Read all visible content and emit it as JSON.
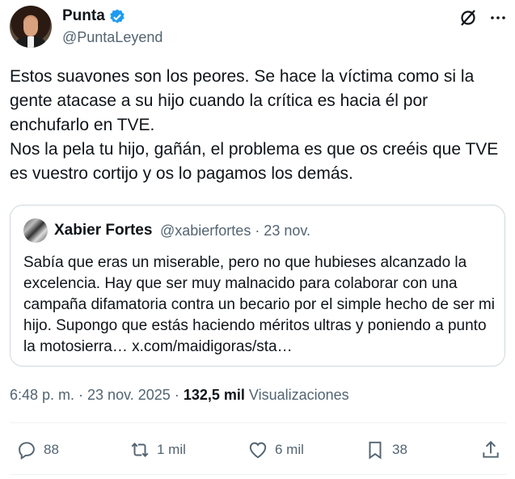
{
  "author": {
    "name": "Punta",
    "handle": "@PuntaLeyend"
  },
  "tweet": {
    "paragraph1": "Estos suavones son los peores. Se hace la víctima como si la gente atacase a su hijo cuando la crítica es hacia él por enchufarlo en TVE.",
    "paragraph2": "Nos la pela tu hijo, gañán, el problema es que os creéis que TVE es vuestro cortijo y os lo pagamos los demás."
  },
  "quote": {
    "name": "Xabier Fortes",
    "handle": "@xabierfortes · 23 nov.",
    "text": "Sabía que eras un miserable, pero no que hubieses alcanzado la excelencia. Hay que ser muy malnacido para colaborar con una campaña difamatoria contra un becario por el simple hecho de ser mi hijo. Supongo que estás haciendo méritos ultras y poniendo a punto la motosierra… x.com/maidigoras/sta…"
  },
  "meta": {
    "time": "6:48 p. m. · 23 nov. 2025 ·",
    "views": "132,5 mil",
    "views_label": "Visualizaciones"
  },
  "actions": {
    "replies": "88",
    "reposts": "1 mil",
    "likes": "6 mil",
    "bookmarks": "38"
  },
  "colors": {
    "verified": "#1d9bf0",
    "secondary_text": "#536471",
    "border": "#cfd9de"
  }
}
